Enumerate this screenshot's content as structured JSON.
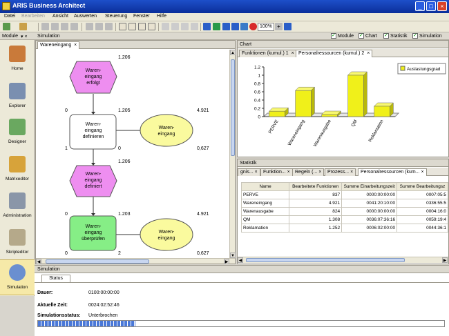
{
  "window": {
    "title": "ARIS Business Architect"
  },
  "menu": [
    "Datei",
    "Bearbeiten",
    "Ansicht",
    "Auswerten",
    "Steuerung",
    "Fenster",
    "Hilfe"
  ],
  "toolbar": {
    "zoom": "100%"
  },
  "modules_label": "Module",
  "sim_tab": "Simulation",
  "view_checks": [
    {
      "label": "Module",
      "checked": true
    },
    {
      "label": "Chart",
      "checked": true
    },
    {
      "label": "Statistik",
      "checked": true
    },
    {
      "label": "Simulation",
      "checked": true
    }
  ],
  "sidebar": [
    {
      "label": "Home",
      "icon": "house-icon",
      "color": "#c97a3a"
    },
    {
      "label": "Explorer",
      "icon": "explorer-icon",
      "color": "#7a8fb0"
    },
    {
      "label": "Designer",
      "icon": "designer-icon",
      "color": "#6aa860"
    },
    {
      "label": "Matrixeditor",
      "icon": "matrix-icon",
      "color": "#d7a33a"
    },
    {
      "label": "Administration",
      "icon": "gears-icon",
      "color": "#8a96a8"
    },
    {
      "label": "Skripteditor",
      "icon": "script-icon",
      "color": "#b5a98a"
    },
    {
      "label": "Simulation",
      "icon": "simulation-icon",
      "color": "#6a8fd0"
    }
  ],
  "editor": {
    "tab": "Wareneingang",
    "nodes": [
      {
        "shape": "event",
        "text": [
          "Waren-",
          "eingang",
          "erfolgt"
        ]
      },
      {
        "shape": "function",
        "text": [
          "Waren-",
          "eingang",
          "definieren"
        ]
      },
      {
        "shape": "event",
        "text": [
          "Waren-",
          "eingang",
          "definiert"
        ]
      },
      {
        "shape": "function",
        "text": [
          "Waren-",
          "eingang",
          "überprüfen"
        ]
      },
      {
        "shape": "resource",
        "text": [
          "Waren-",
          "eingang"
        ]
      },
      {
        "shape": "resource",
        "text": [
          "Waren-",
          "eingang"
        ]
      }
    ],
    "numbers": [
      "1.206",
      "0",
      "1.205",
      "4.921",
      "1",
      "0",
      "0,627",
      "1.206",
      "0",
      "1.203",
      "4.921",
      "0",
      "2",
      "0,627"
    ]
  },
  "chart_panel": {
    "title": "Chart",
    "tabs": [
      "Funktionen (kumul.) 1",
      "Personalressourcen (kumul.) 2"
    ]
  },
  "chart_data": {
    "type": "bar",
    "categories": [
      "PERVE",
      "Wareneingang",
      "Warenausgabe",
      "QM",
      "Reklamation"
    ],
    "series": [
      {
        "name": "Auslastungsgrad",
        "values": [
          0.13,
          0.63,
          0.05,
          1.0,
          0.25
        ]
      }
    ],
    "ylim": [
      0,
      1.2
    ],
    "yticks": [
      "0",
      "0.2",
      "0.4",
      "0.6",
      "0.8",
      "1",
      "1.2"
    ],
    "color": "#f0f01a",
    "legend": "top-right"
  },
  "stats": {
    "title": "Statistik",
    "tabs": [
      "gnis...",
      "Funktion...",
      "Regeln (...",
      "Prozess...",
      "Personalressourcen (kum..."
    ],
    "columns": [
      "Name",
      "Bearbeitete Funktionen",
      "Summe Einarbeitungszeit",
      "Summe Bearbeitungsz"
    ],
    "rows": [
      [
        "PERVE",
        "837",
        "0000:00:00:00",
        "0007:05:5"
      ],
      [
        "Wareneingang",
        "4.921",
        "0041:20:10:00",
        "0336:55:5"
      ],
      [
        "Warenausgabe",
        "824",
        "0000:00:00:00",
        "0004:16:0"
      ],
      [
        "QM",
        "1.308",
        "0036:07:36:16",
        "0059:19:4"
      ],
      [
        "Reklamation",
        "1.252",
        "0006:02:00:00",
        "0044:36:1"
      ]
    ]
  },
  "simulation": {
    "title": "Simulation",
    "status_tab": "Status",
    "dauer_label": "Dauer:",
    "dauer_value": "0100:00:00:00",
    "zeit_label": "Aktuelle Zeit:",
    "zeit_value": "0024:02:52:46",
    "status_label": "Simulationsstatus:",
    "status_value": "Unterbrochen",
    "progress": 0.24
  }
}
